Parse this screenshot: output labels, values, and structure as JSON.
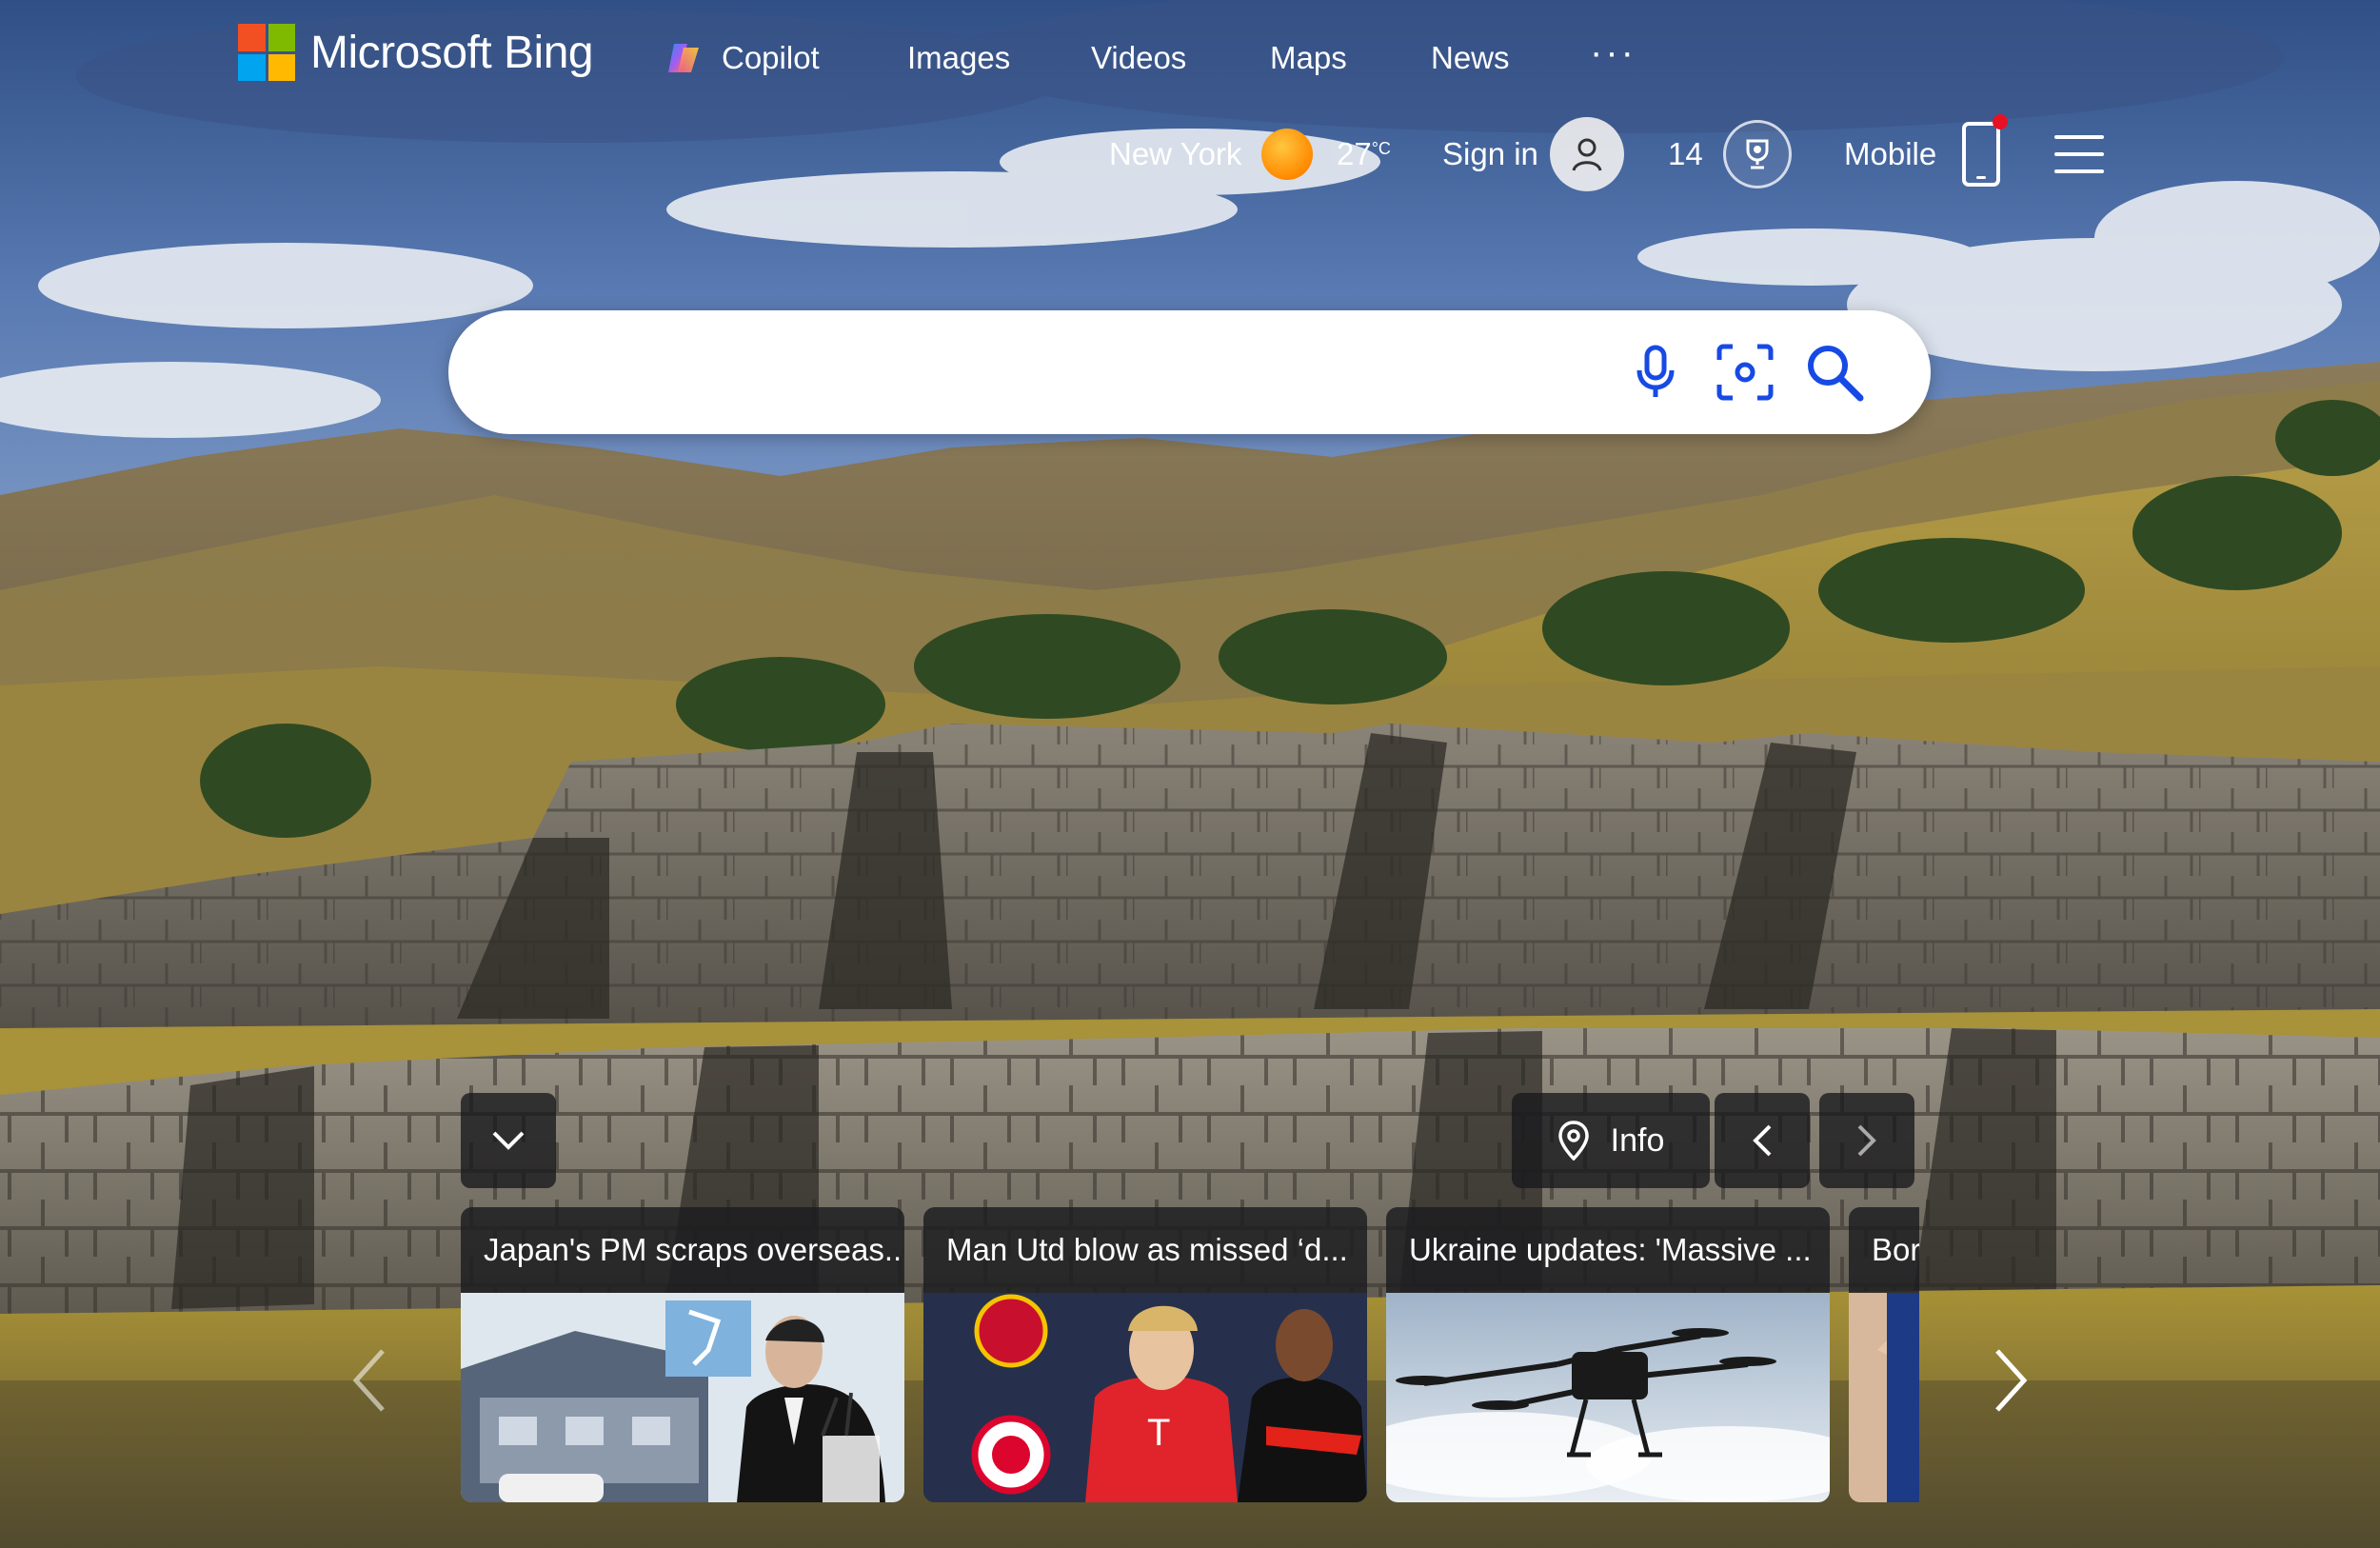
{
  "brand": {
    "name": "Microsoft Bing",
    "logo_colors": [
      "#f25022",
      "#7fba00",
      "#00a4ef",
      "#ffb900"
    ]
  },
  "nav": {
    "items": [
      {
        "label": "Copilot",
        "icon": "copilot-icon"
      },
      {
        "label": "Images"
      },
      {
        "label": "Videos"
      },
      {
        "label": "Maps"
      },
      {
        "label": "News"
      }
    ],
    "more_label": "···"
  },
  "subheader": {
    "location": "New York",
    "weather_icon": "sun-icon",
    "temperature": "27",
    "temp_unit": "°C",
    "sign_in": "Sign in",
    "rewards_count": "14",
    "mobile_label": "Mobile"
  },
  "search": {
    "value": "",
    "placeholder": "",
    "accent": "#174ae4",
    "icons": [
      "microphone-icon",
      "visual-search-icon",
      "search-icon"
    ]
  },
  "image_controls": {
    "info_label": "Info"
  },
  "news": {
    "cards": [
      {
        "title": "Japan's PM scraps overseas..."
      },
      {
        "title": "Man Utd blow as missed ‘d..."
      },
      {
        "title": "Ukraine updates: 'Massive ..."
      },
      {
        "title": "Bor"
      }
    ]
  }
}
